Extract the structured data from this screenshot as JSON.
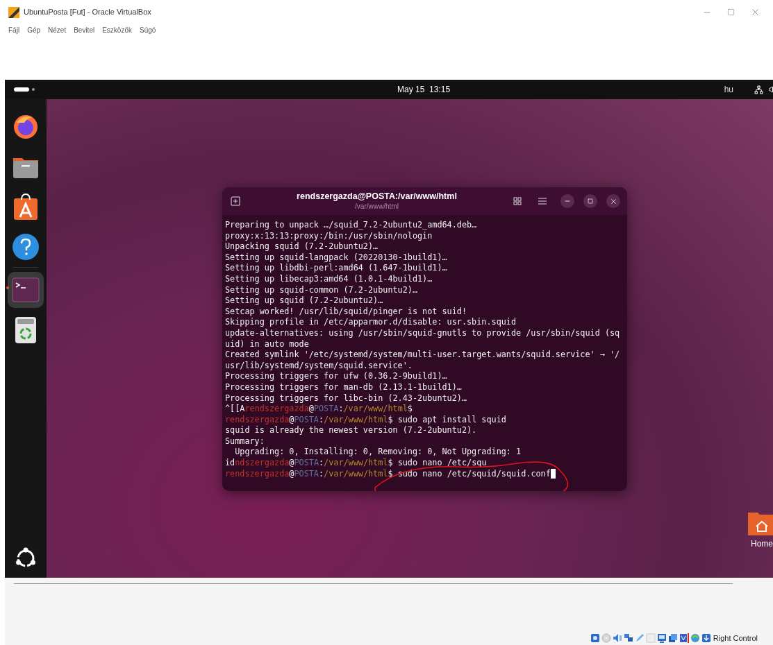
{
  "window": {
    "title": "UbuntuPosta [Fut] - Oracle VirtualBox"
  },
  "menu": [
    "Fájl",
    "Gép",
    "Nézet",
    "Bevitel",
    "Eszközök",
    "Súgó"
  ],
  "top_bar": {
    "datetime": "May 15  13:15",
    "keyboard_layout": "hu"
  },
  "dock": {
    "items": [
      {
        "kind": "browser",
        "running": false,
        "selected": false
      },
      {
        "kind": "files",
        "running": false,
        "selected": false
      },
      {
        "kind": "software",
        "running": false,
        "selected": false
      },
      {
        "kind": "help",
        "running": false,
        "selected": false
      },
      {
        "kind": "terminal",
        "running": true,
        "selected": true
      },
      {
        "kind": "trash",
        "running": false,
        "selected": false
      }
    ]
  },
  "terminal": {
    "title": "rendszergazda@POSTA:/var/www/html",
    "subtitle": "/var/www/html",
    "lines": [
      {
        "segments": [
          {
            "kind": "plain",
            "text": "Preparing to unpack …/squid_7.2-2ubuntu2_amd64.deb…"
          }
        ]
      },
      {
        "segments": [
          {
            "kind": "plain",
            "text": "proxy:x:13:13:proxy:/bin:/usr/sbin/nologin"
          }
        ]
      },
      {
        "segments": [
          {
            "kind": "plain",
            "text": "Unpacking squid (7.2-2ubuntu2)…"
          }
        ]
      },
      {
        "segments": [
          {
            "kind": "plain",
            "text": "Setting up squid-langpack (20220130-1build1)…"
          }
        ]
      },
      {
        "segments": [
          {
            "kind": "plain",
            "text": "Setting up libdbi-perl:amd64 (1.647-1build1)…"
          }
        ]
      },
      {
        "segments": [
          {
            "kind": "plain",
            "text": "Setting up libecap3:amd64 (1.0.1-4build1)…"
          }
        ]
      },
      {
        "segments": [
          {
            "kind": "plain",
            "text": "Setting up squid-common (7.2-2ubuntu2)…"
          }
        ]
      },
      {
        "segments": [
          {
            "kind": "plain",
            "text": "Setting up squid (7.2-2ubuntu2)…"
          }
        ]
      },
      {
        "segments": [
          {
            "kind": "plain",
            "text": "Setcap worked! /usr/lib/squid/pinger is not suid!"
          }
        ]
      },
      {
        "segments": [
          {
            "kind": "plain",
            "text": "Skipping profile in /etc/apparmor.d/disable: usr.sbin.squid"
          }
        ]
      },
      {
        "segments": [
          {
            "kind": "plain",
            "text": "update-alternatives: using /usr/sbin/squid-gnutls to provide /usr/sbin/squid (sq"
          }
        ]
      },
      {
        "segments": [
          {
            "kind": "plain",
            "text": "uid) in auto mode"
          }
        ]
      },
      {
        "segments": [
          {
            "kind": "plain",
            "text": "Created symlink '/etc/systemd/system/multi-user.target.wants/squid.service' → '/"
          }
        ]
      },
      {
        "segments": [
          {
            "kind": "plain",
            "text": "usr/lib/systemd/system/squid.service'."
          }
        ]
      },
      {
        "segments": [
          {
            "kind": "plain",
            "text": "Processing triggers for ufw (0.36.2-9build1)…"
          }
        ]
      },
      {
        "segments": [
          {
            "kind": "plain",
            "text": "Processing triggers for man-db (2.13.1-1build1)…"
          }
        ]
      },
      {
        "segments": [
          {
            "kind": "plain",
            "text": "Processing triggers for libc-bin (2.43-2ubuntu2)…"
          }
        ]
      },
      {
        "segments": [
          {
            "kind": "plain",
            "text": "^[[A"
          },
          {
            "kind": "user",
            "text": "rendszergazda"
          },
          {
            "kind": "plain",
            "text": "@"
          },
          {
            "kind": "host",
            "text": "POSTA"
          },
          {
            "kind": "plain",
            "text": ":"
          },
          {
            "kind": "path",
            "text": "/var/www/html"
          },
          {
            "kind": "plain",
            "text": "$"
          }
        ]
      },
      {
        "segments": [
          {
            "kind": "user",
            "text": "rendszergazda"
          },
          {
            "kind": "plain",
            "text": "@"
          },
          {
            "kind": "host",
            "text": "POSTA"
          },
          {
            "kind": "plain",
            "text": ":"
          },
          {
            "kind": "path",
            "text": "/var/www/html"
          },
          {
            "kind": "plain",
            "text": "$ sudo apt install squid"
          }
        ]
      },
      {
        "segments": [
          {
            "kind": "plain",
            "text": "squid is already the newest version (7.2-2ubuntu2)."
          }
        ]
      },
      {
        "segments": [
          {
            "kind": "plain",
            "text": "Summary:"
          }
        ]
      },
      {
        "segments": [
          {
            "kind": "plain",
            "text": "  Upgrading: 0, Installing: 0, Removing: 0, Not Upgrading: 1"
          }
        ]
      },
      {
        "segments": [
          {
            "kind": "plain",
            "text": "id"
          },
          {
            "kind": "user",
            "text": "ndszergazda"
          },
          {
            "kind": "plain",
            "text": "@"
          },
          {
            "kind": "host",
            "text": "POSTA"
          },
          {
            "kind": "plain",
            "text": ":"
          },
          {
            "kind": "path",
            "text": "/var/www/html"
          },
          {
            "kind": "plain",
            "text": "$ sudo nano /etc/squ"
          }
        ]
      },
      {
        "segments": [
          {
            "kind": "user",
            "text": "rendszergazda"
          },
          {
            "kind": "plain",
            "text": "@"
          },
          {
            "kind": "host",
            "text": "POSTA"
          },
          {
            "kind": "plain",
            "text": ":"
          },
          {
            "kind": "path",
            "text": "/var/www/html"
          },
          {
            "kind": "plain",
            "text": "$ sudo nano /etc/squid/squid.conf"
          }
        ]
      }
    ]
  },
  "desktop_icons": [
    {
      "label": "Home"
    }
  ],
  "status_bar": {
    "host_key": "Right Control"
  }
}
